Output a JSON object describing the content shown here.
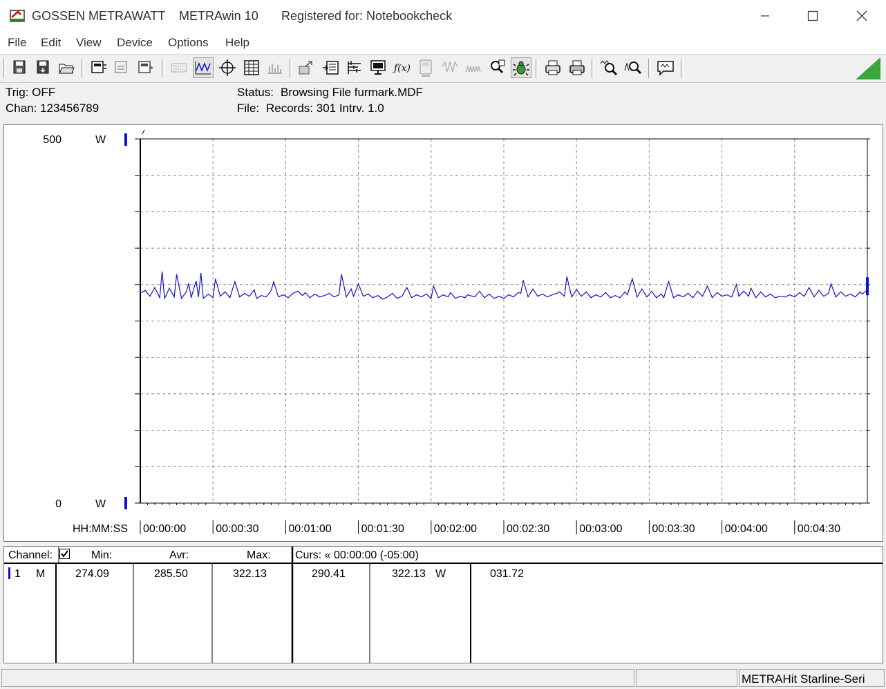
{
  "window": {
    "title_brand": "GOSSEN METRAWATT",
    "title_app": "METRAwin 10",
    "title_registered": "Registered for: Notebookcheck"
  },
  "menu": [
    "File",
    "Edit",
    "View",
    "Device",
    "Options",
    "Help"
  ],
  "toolbar_icons": [
    "save-file-icon",
    "save-data-icon",
    "open-file-icon",
    "device-read-icon",
    "device-config-icon",
    "device-write-icon",
    "keyboard-icon",
    "waveform-view-icon",
    "crosshair-view-icon",
    "table-view-icon",
    "bar-view-icon",
    "export-icon",
    "import-icon",
    "list-icon",
    "monitor-icon",
    "formula-icon",
    "meter-icon",
    "trigger-icon",
    "signal-icon",
    "search-icon",
    "bug-icon",
    "print-preview-icon",
    "print-icon",
    "zoom-in-icon",
    "zoom-out-icon",
    "comment-icon"
  ],
  "info": {
    "trig": "Trig: OFF",
    "chan": "Chan:  123456789",
    "status_label": "Status:",
    "status_value": "Browsing File furmark.MDF",
    "file_label": "File:",
    "file_value": "Records: 301   Intrv. 1.0"
  },
  "chart": {
    "ymax_label": "500",
    "ymin_label": "0",
    "unit_top": "W",
    "unit_bottom": "W",
    "x_axis_label": "HH:MM:SS"
  },
  "chart_data": {
    "type": "line",
    "ylim": [
      0,
      500
    ],
    "xlim": [
      0,
      300
    ],
    "x_ticks": [
      "00:00:00",
      "00:00:30",
      "00:01:00",
      "00:01:30",
      "00:02:00",
      "00:02:30",
      "00:03:00",
      "00:03:30",
      "00:04:00",
      "00:04:30"
    ],
    "series": [
      {
        "color": "#1010d0",
        "points": [
          [
            0,
            288
          ],
          [
            2,
            292
          ],
          [
            4,
            284
          ],
          [
            6,
            296
          ],
          [
            8,
            282
          ],
          [
            9,
            318
          ],
          [
            10,
            281
          ],
          [
            12,
            295
          ],
          [
            14,
            283
          ],
          [
            15,
            314
          ],
          [
            17,
            281
          ],
          [
            19,
            290
          ],
          [
            20,
            302
          ],
          [
            21,
            282
          ],
          [
            23,
            305
          ],
          [
            24,
            283
          ],
          [
            25,
            316
          ],
          [
            26,
            281
          ],
          [
            28,
            287
          ],
          [
            30,
            282
          ],
          [
            31,
            308
          ],
          [
            33,
            284
          ],
          [
            35,
            290
          ],
          [
            37,
            282
          ],
          [
            39,
            304
          ],
          [
            41,
            283
          ],
          [
            43,
            288
          ],
          [
            45,
            284
          ],
          [
            47,
            293
          ],
          [
            48,
            281
          ],
          [
            50,
            285
          ],
          [
            52,
            283
          ],
          [
            54,
            292
          ],
          [
            55,
            304
          ],
          [
            57,
            283
          ],
          [
            59,
            286
          ],
          [
            61,
            282
          ],
          [
            63,
            288
          ],
          [
            65,
            291
          ],
          [
            67,
            285
          ],
          [
            68,
            289
          ],
          [
            70,
            282
          ],
          [
            72,
            287
          ],
          [
            74,
            283
          ],
          [
            76,
            285
          ],
          [
            78,
            288
          ],
          [
            80,
            283
          ],
          [
            82,
            286
          ],
          [
            83,
            314
          ],
          [
            85,
            283
          ],
          [
            87,
            294
          ],
          [
            88,
            284
          ],
          [
            90,
            301
          ],
          [
            92,
            284
          ],
          [
            94,
            287
          ],
          [
            96,
            282
          ],
          [
            98,
            285
          ],
          [
            100,
            280
          ],
          [
            102,
            283
          ],
          [
            104,
            288
          ],
          [
            106,
            281
          ],
          [
            108,
            284
          ],
          [
            110,
            296
          ],
          [
            112,
            282
          ],
          [
            114,
            286
          ],
          [
            116,
            283
          ],
          [
            118,
            287
          ],
          [
            120,
            281
          ],
          [
            121,
            298
          ],
          [
            123,
            282
          ],
          [
            125,
            286
          ],
          [
            127,
            283
          ],
          [
            128,
            289
          ],
          [
            130,
            281
          ],
          [
            132,
            284
          ],
          [
            134,
            282
          ],
          [
            135,
            286
          ],
          [
            138,
            283
          ],
          [
            140,
            291
          ],
          [
            142,
            282
          ],
          [
            144,
            287
          ],
          [
            146,
            281
          ],
          [
            148,
            284
          ],
          [
            150,
            281
          ],
          [
            152,
            286
          ],
          [
            154,
            283
          ],
          [
            156,
            289
          ],
          [
            157,
            288
          ],
          [
            158,
            306
          ],
          [
            160,
            283
          ],
          [
            162,
            294
          ],
          [
            164,
            284
          ],
          [
            166,
            287
          ],
          [
            168,
            283
          ],
          [
            170,
            286
          ],
          [
            172,
            288
          ],
          [
            173,
            290
          ],
          [
            175,
            284
          ],
          [
            176,
            311
          ],
          [
            178,
            283
          ],
          [
            180,
            293
          ],
          [
            182,
            284
          ],
          [
            184,
            290
          ],
          [
            186,
            282
          ],
          [
            188,
            286
          ],
          [
            190,
            283
          ],
          [
            192,
            289
          ],
          [
            194,
            282
          ],
          [
            196,
            285
          ],
          [
            198,
            282
          ],
          [
            200,
            290
          ],
          [
            201,
            286
          ],
          [
            203,
            308
          ],
          [
            205,
            283
          ],
          [
            207,
            294
          ],
          [
            209,
            283
          ],
          [
            211,
            291
          ],
          [
            213,
            282
          ],
          [
            215,
            287
          ],
          [
            216,
            282
          ],
          [
            218,
            304
          ],
          [
            220,
            282
          ],
          [
            222,
            286
          ],
          [
            224,
            283
          ],
          [
            226,
            288
          ],
          [
            228,
            282
          ],
          [
            230,
            291
          ],
          [
            232,
            284
          ],
          [
            234,
            298
          ],
          [
            236,
            282
          ],
          [
            238,
            289
          ],
          [
            240,
            284
          ],
          [
            242,
            286
          ],
          [
            244,
            283
          ],
          [
            246,
            300
          ],
          [
            247,
            284
          ],
          [
            249,
            291
          ],
          [
            251,
            284
          ],
          [
            252,
            295
          ],
          [
            254,
            282
          ],
          [
            256,
            290
          ],
          [
            258,
            283
          ],
          [
            260,
            287
          ],
          [
            262,
            282
          ],
          [
            264,
            284
          ],
          [
            266,
            283
          ],
          [
            268,
            286
          ],
          [
            270,
            283
          ],
          [
            272,
            289
          ],
          [
            274,
            284
          ],
          [
            276,
            296
          ],
          [
            278,
            283
          ],
          [
            280,
            292
          ],
          [
            282,
            284
          ],
          [
            284,
            288
          ],
          [
            285,
            301
          ],
          [
            287,
            283
          ],
          [
            289,
            290
          ],
          [
            291,
            284
          ],
          [
            293,
            287
          ],
          [
            295,
            283
          ],
          [
            297,
            290
          ],
          [
            298,
            287
          ],
          [
            300,
            293
          ]
        ]
      }
    ]
  },
  "table": {
    "headers": {
      "channel": "Channel:",
      "min": "Min:",
      "avr": "Avr:",
      "max": "Max:",
      "curs": "Curs: « 00:00:00 (-05:00)"
    },
    "row": {
      "num": "1",
      "mode": "M",
      "min": "274.09",
      "avr": "285.50",
      "max": "322.13",
      "c1": "290.41",
      "c2": "322.13",
      "unit": "W",
      "c3": "031.72"
    },
    "checkbox_checked": true
  },
  "statusbar": {
    "device": "METRAHit Starline-Seri"
  }
}
